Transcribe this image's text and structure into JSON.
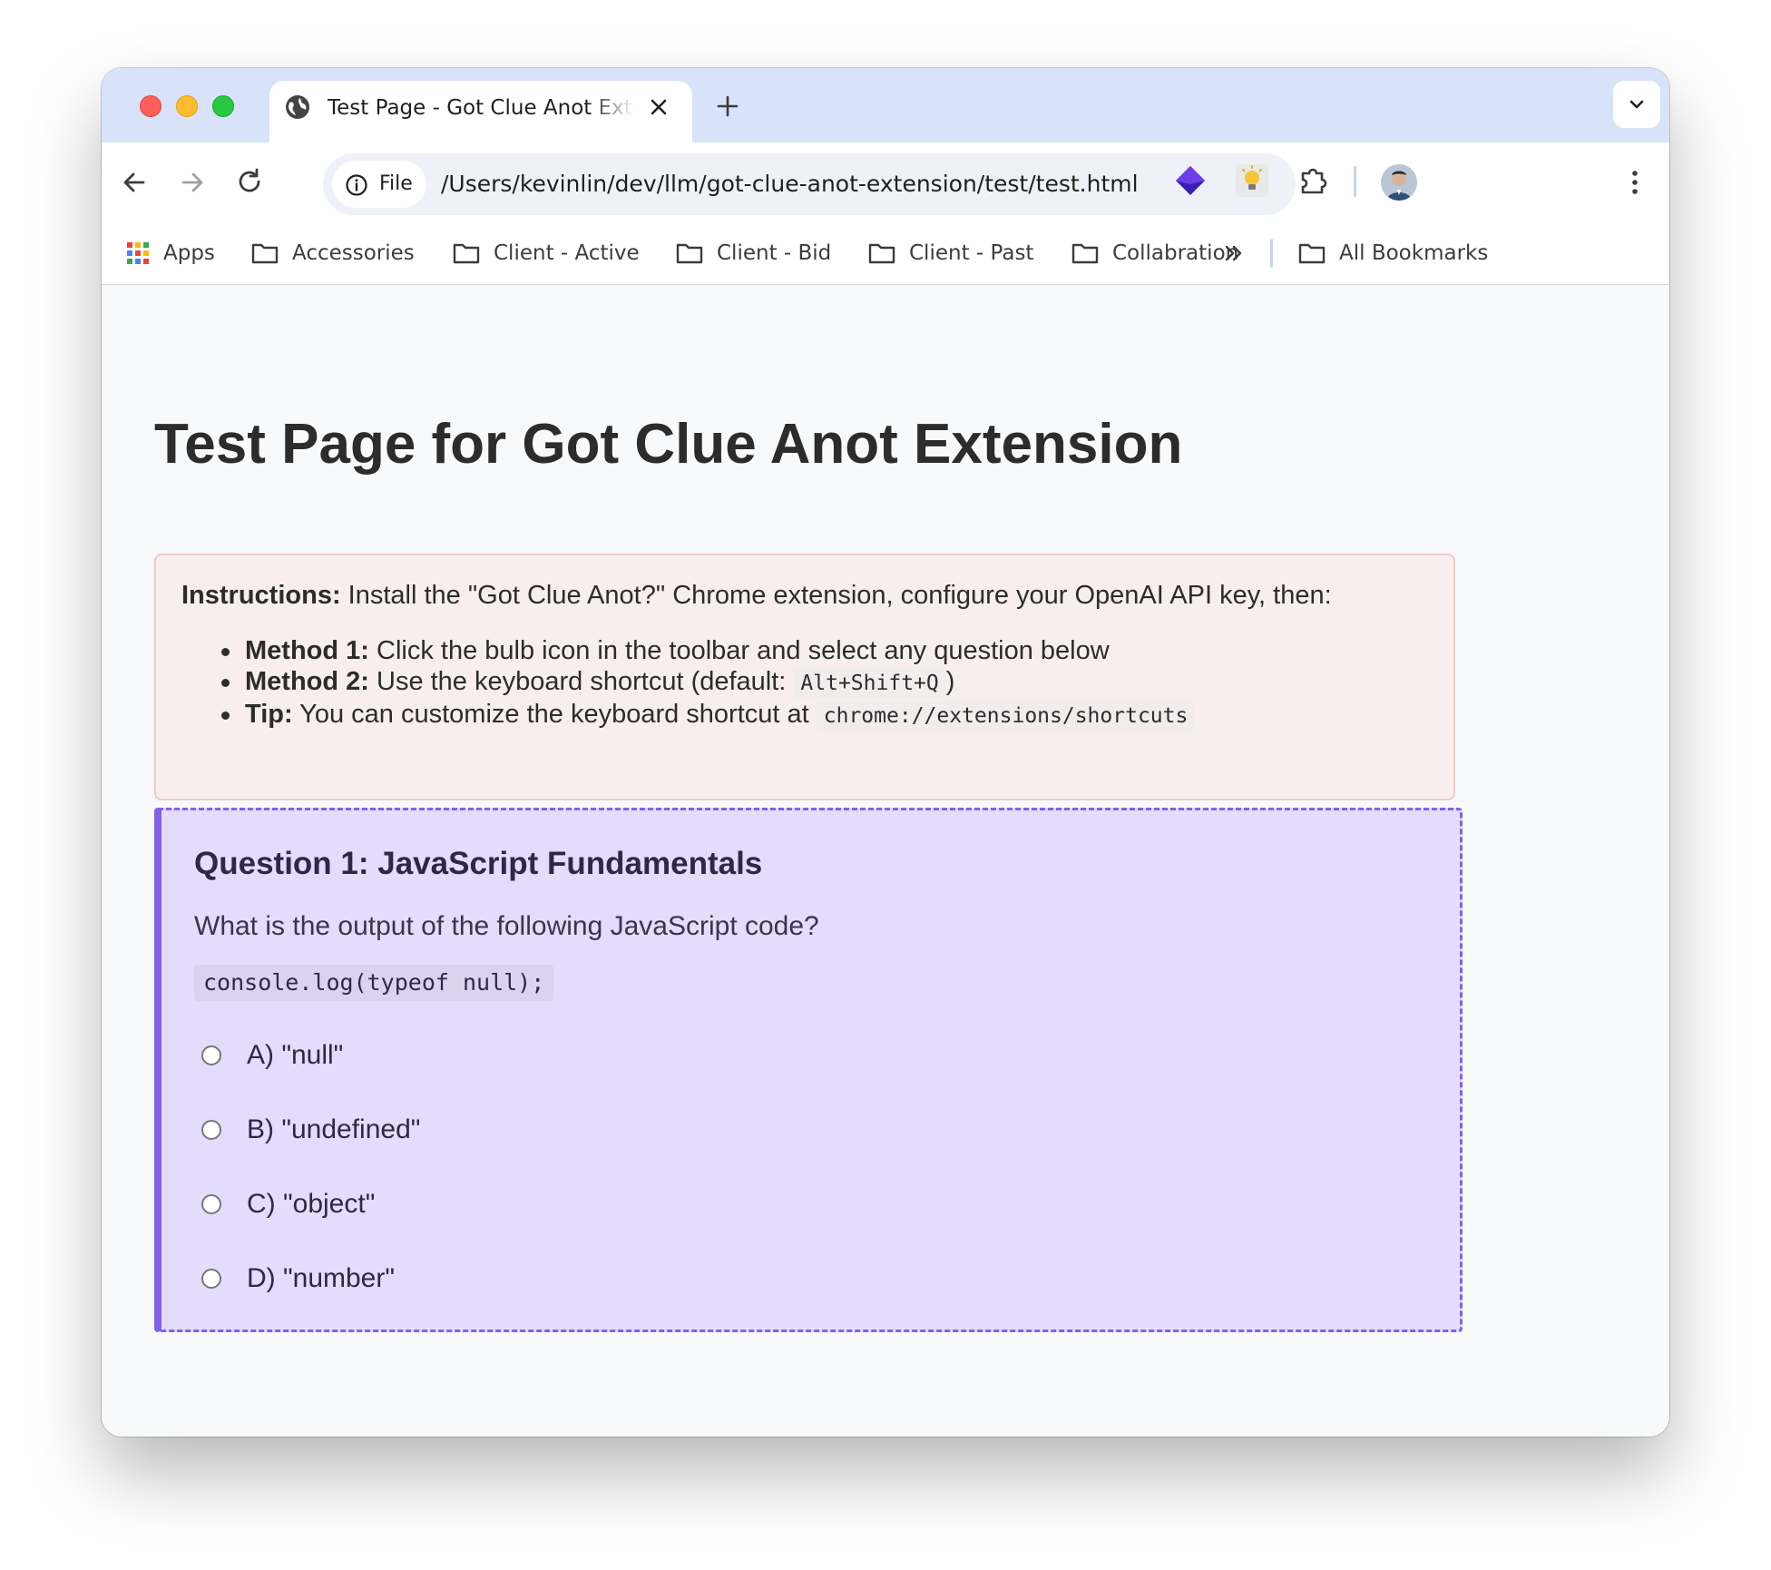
{
  "window": {
    "tab_title": "Test Page - Got Clue Anot Extension",
    "icons": [
      "globe-icon",
      "close-icon",
      "plus-icon",
      "chevron-down-icon"
    ]
  },
  "toolbar": {
    "chip_label": "File",
    "url": "/Users/kevinlin/dev/llm/got-clue-anot-extension/test/test.html",
    "icons": [
      "back-arrow-icon",
      "forward-arrow-icon",
      "reload-icon",
      "info-icon",
      "star-icon",
      "diamond-extension-icon",
      "bulb-extension-icon",
      "puzzle-extensions-icon",
      "avatar",
      "kebab-menu-icon"
    ]
  },
  "bookmarks": {
    "apps": "Apps",
    "items": [
      "Accessories",
      "Client - Active",
      "Client - Bid",
      "Client - Past",
      "Collabration"
    ],
    "all_bookmarks": "All Bookmarks"
  },
  "page": {
    "title": "Test Page for Got Clue Anot Extension",
    "instructions": {
      "lead_bold": "Instructions:",
      "lead_text": " Install the \"Got Clue Anot?\" Chrome extension, configure your OpenAI API key, then:",
      "items": [
        {
          "bold": "Method 1:",
          "text": " Click the bulb icon in the toolbar and select any question below",
          "code": ""
        },
        {
          "bold": "Method 2:",
          "text": " Use the keyboard shortcut (default: ",
          "code": "Alt+Shift+Q",
          "after": ")"
        },
        {
          "bold": "Tip:",
          "text": " You can customize the keyboard shortcut at ",
          "code": "chrome://extensions/shortcuts"
        }
      ]
    },
    "question": {
      "title": "Question 1: JavaScript Fundamentals",
      "text": "What is the output of the following JavaScript code?",
      "code": "console.log(typeof null);",
      "options": [
        "A) \"null\"",
        "B) \"undefined\"",
        "C) \"object\"",
        "D) \"number\""
      ]
    }
  },
  "colors": {
    "tabstrip": "#d8e2f8",
    "instructions_bg": "#f9eeee",
    "question_bg": "#e3dcfb",
    "question_accent": "#8460e8"
  }
}
